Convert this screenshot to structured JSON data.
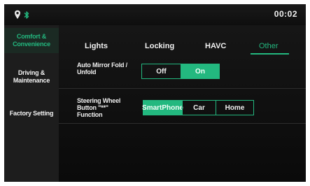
{
  "status": {
    "clock": "00:02",
    "icons": [
      "location-pin-icon",
      "bluetooth-icon"
    ],
    "accent": "#23b87f"
  },
  "sidebar": {
    "items": [
      {
        "label": "Comfort &\nConvenience",
        "active": true
      },
      {
        "label": "Driving &\nMaintenance",
        "active": false
      },
      {
        "label": "Factory Setting",
        "active": false
      }
    ]
  },
  "tabs": [
    {
      "label": "Lights",
      "active": false
    },
    {
      "label": "Locking",
      "active": false
    },
    {
      "label": "HAVC",
      "active": false
    },
    {
      "label": "Other",
      "active": true
    }
  ],
  "settings": {
    "mirror": {
      "label": "Auto Mirror Fold /\nUnfold",
      "options": [
        "Off",
        "On"
      ],
      "selected": "On"
    },
    "wheel": {
      "label": "Steering Wheel\nButton \"**\"\nFunction",
      "options": [
        "SmartPhone",
        "Car",
        "Home"
      ],
      "selected": "SmartPhone"
    }
  }
}
